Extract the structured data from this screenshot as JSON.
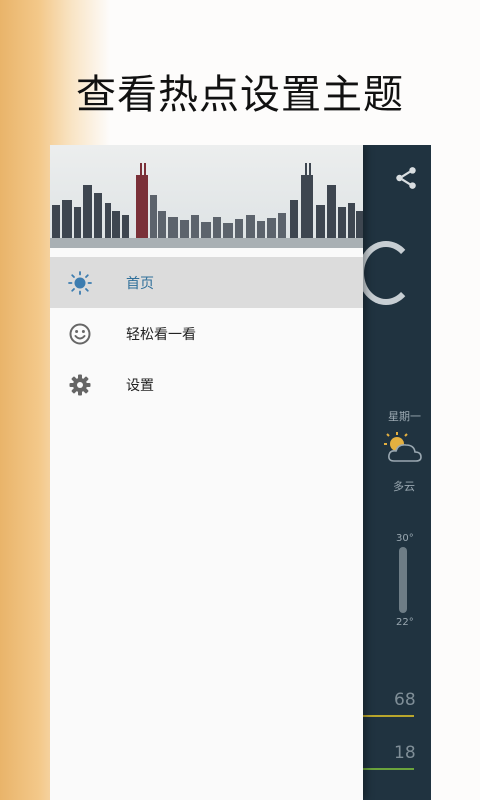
{
  "headline": "查看热点设置主题",
  "drawer": {
    "items": [
      {
        "label": "首页",
        "icon": "sun-icon",
        "active": true
      },
      {
        "label": "轻松看一看",
        "icon": "smiley-icon",
        "active": false
      },
      {
        "label": "设置",
        "icon": "gear-icon",
        "active": false
      }
    ]
  },
  "background_app": {
    "weekday": "星期一",
    "weather": "多云",
    "temp_high": "30°",
    "temp_low": "22°",
    "aqi": "68",
    "pm": "18"
  },
  "colors": {
    "accent": "#2f6f9a",
    "app_bg": "#203340",
    "active_item_bg": "#dcdcdc"
  }
}
